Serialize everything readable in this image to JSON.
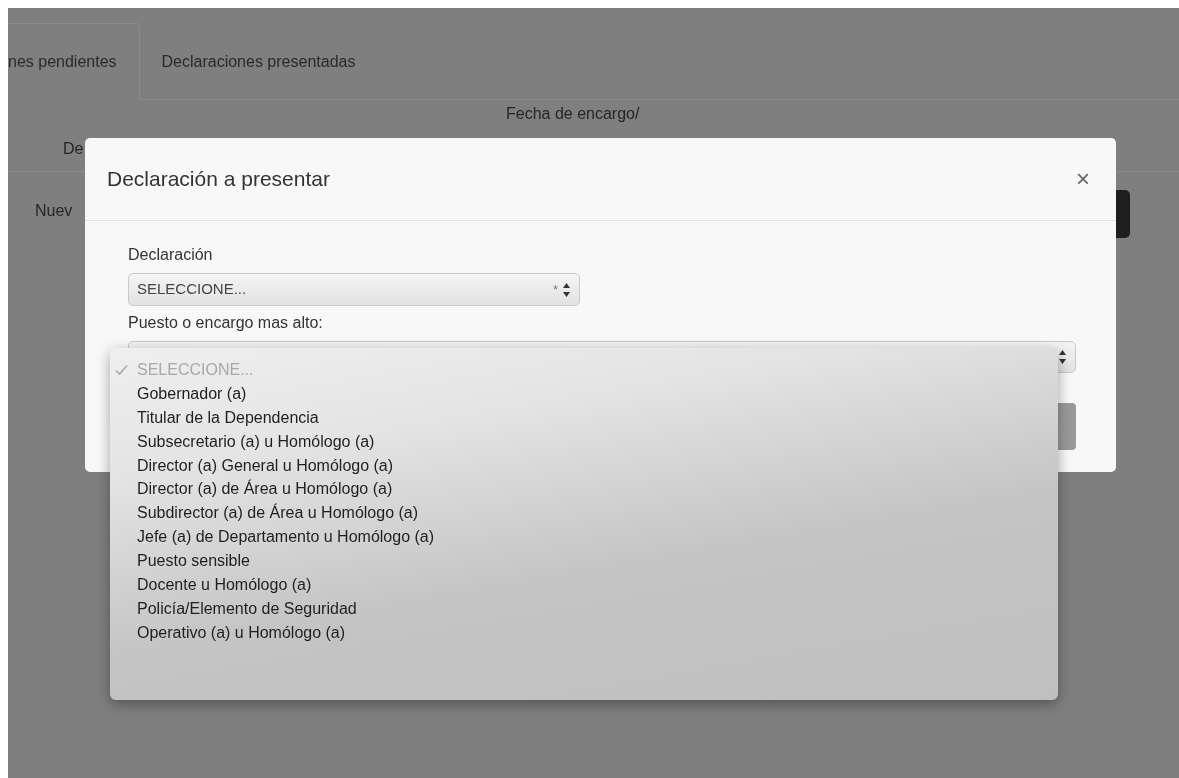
{
  "tabs": [
    {
      "label": "nes pendientes",
      "selected": true
    },
    {
      "label": "Declaraciones presentadas",
      "selected": false
    }
  ],
  "table": {
    "columns": [
      "De",
      "Fecha de encargo/"
    ],
    "rows": [
      {
        "cells": [
          "Nuev"
        ]
      }
    ]
  },
  "modal": {
    "title": "Declaración a presentar",
    "close": "×",
    "fields": [
      {
        "label": "Declaración",
        "value": "SELECCIONE...",
        "marker": "*",
        "expanded": false
      },
      {
        "label": "Puesto o encargo mas alto:",
        "expanded": true,
        "options": [
          {
            "label": "SELECCIONE...",
            "selected": true
          },
          {
            "label": "Gobernador (a)",
            "selected": false
          },
          {
            "label": "Titular de la Dependencia",
            "selected": false
          },
          {
            "label": "Subsecretario (a) u Homólogo (a)",
            "selected": false
          },
          {
            "label": "Director (a) General u Homólogo (a)",
            "selected": false
          },
          {
            "label": "Director (a) de Área u Homólogo (a)",
            "selected": false
          },
          {
            "label": "Subdirector (a) de Área u Homólogo (a)",
            "selected": false
          },
          {
            "label": "Jefe (a) de Departamento u Homólogo (a)",
            "selected": false
          },
          {
            "label": "Puesto sensible",
            "selected": false
          },
          {
            "label": "Docente u Homólogo (a)",
            "selected": false
          },
          {
            "label": "Policía/Elemento de Seguridad",
            "selected": false
          },
          {
            "label": "Operativo (a) u Homólogo (a)",
            "selected": false
          }
        ]
      }
    ]
  }
}
